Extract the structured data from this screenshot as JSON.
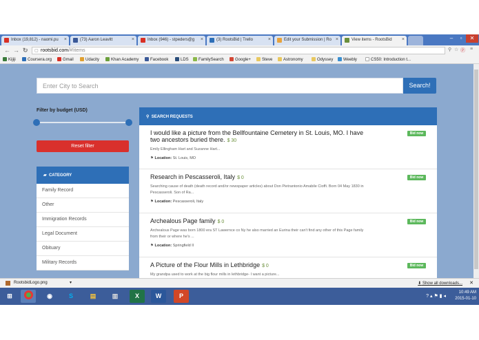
{
  "tabs": [
    {
      "label": "Inbox (19,812) - naomi.pu",
      "color": "#d93025"
    },
    {
      "label": "(73) Aaron Leavitt",
      "color": "#3b5998"
    },
    {
      "label": "Inbox (946) - stpeders@g",
      "color": "#d93025"
    },
    {
      "label": "(3) RootsBid | Trello",
      "color": "#2e6fb7"
    },
    {
      "label": "Edit your Submission | Ro",
      "color": "#e8a33d"
    },
    {
      "label": "View items - RootsBid",
      "color": "#6b8f3b"
    }
  ],
  "address": {
    "host": "rootsbid.com",
    "path": "/#!items"
  },
  "bookmarks": [
    {
      "label": "Kijiji",
      "color": "#3a7a3a"
    },
    {
      "label": "Coursera.org",
      "color": "#2e6fb7"
    },
    {
      "label": "Gmail",
      "color": "#d93025"
    },
    {
      "label": "Udacity",
      "color": "#e0a030"
    },
    {
      "label": "Khan Academy",
      "color": "#6b9f3b"
    },
    {
      "label": "Facebook",
      "color": "#3b5998"
    },
    {
      "label": "LDS",
      "color": "#2a4d7a"
    },
    {
      "label": "FamilySearch",
      "color": "#8bb84a"
    },
    {
      "label": "Google+",
      "color": "#d34836"
    },
    {
      "label": "Steve",
      "color": "#e8c860"
    },
    {
      "label": "Astronomy",
      "color": "#e8c860"
    },
    {
      "label": "Odyssey",
      "color": "#e8c860"
    },
    {
      "label": "Weebly",
      "color": "#3b8fd0"
    },
    {
      "label": "CS50: Introduction t...",
      "color": "#dddddd"
    }
  ],
  "search": {
    "placeholder": "Enter City to Search",
    "button": "Search!"
  },
  "filter": {
    "label": "Filter by budget (USD)",
    "reset": "Reset filter",
    "min": 0,
    "max": 1
  },
  "categories": {
    "header": "CATEGORY",
    "items": [
      "Family Record",
      "Other",
      "Immigration Records",
      "Legal Document",
      "Obituary",
      "Military Records"
    ]
  },
  "requests": {
    "header": "SEARCH REQUESTS",
    "bid_label": "Bid now",
    "location_label": "Location:",
    "items": [
      {
        "title": "I would like a picture from the Bellfountaine Cemetery in St. Louis, MO. I have two ancestors buried there.",
        "price": "$ 30",
        "desc": "Emily Ellingham Hart and Suzanne Hart...",
        "location": "St. Louis, MO"
      },
      {
        "title": "Research in Pescasseroli, Italy",
        "price": "$ 0",
        "desc": "Searching cause of death (death record and/or newspaper articles) about Don Pietrantonio Amabile Cioffi. Born 04 May 1830 in Pescasseroli. Son of Ra...",
        "location": "Pescasseroli, Italy"
      },
      {
        "title": "Archealous Page family",
        "price": "$ 0",
        "desc": "Archealous Page was born 1800 era ST Lawernce co Ny he also married an Eurina their can't find any other of this Page family from their or where he's ...",
        "location": "Springfield Il"
      },
      {
        "title": "A Picture of the Flour Mills in Lethbridge",
        "price": "$ 0",
        "desc": "My grandpa used to work at the big flour mills in lethbridge- I want a picture...",
        "location": ""
      }
    ]
  },
  "downloads": {
    "file": "RootsbidLogo.png",
    "show_all": "Show all downloads..."
  },
  "taskbar": {
    "time": "10:49 AM",
    "date": "2015-01-10"
  }
}
